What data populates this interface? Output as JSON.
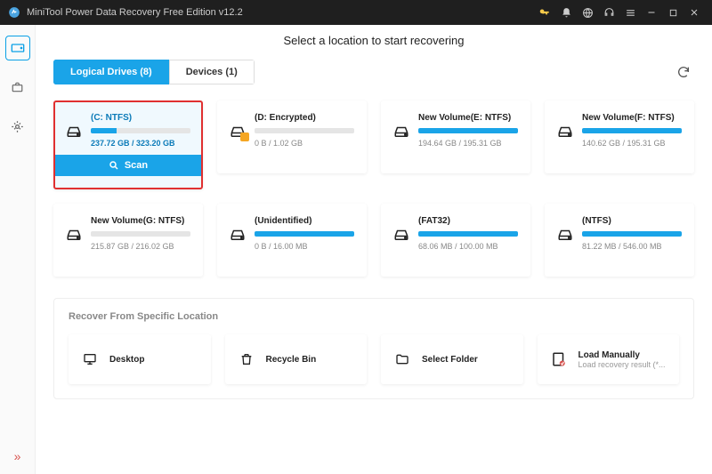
{
  "window": {
    "title": "MiniTool Power Data Recovery Free Edition v12.2"
  },
  "heading": "Select a location to start recovering",
  "tabs": {
    "logical": "Logical Drives (8)",
    "devices": "Devices (1)"
  },
  "drives": [
    {
      "label": "(C: NTFS)",
      "size": "237.72 GB / 323.20 GB",
      "fill": 26,
      "selected": true,
      "locked": false
    },
    {
      "label": "(D: Encrypted)",
      "size": "0 B / 1.02 GB",
      "fill": 0,
      "selected": false,
      "locked": true
    },
    {
      "label": "New Volume(E: NTFS)",
      "size": "194.64 GB / 195.31 GB",
      "fill": 100,
      "selected": false,
      "locked": false
    },
    {
      "label": "New Volume(F: NTFS)",
      "size": "140.62 GB / 195.31 GB",
      "fill": 100,
      "selected": false,
      "locked": false
    },
    {
      "label": "New Volume(G: NTFS)",
      "size": "215.87 GB / 216.02 GB",
      "fill": 0,
      "selected": false,
      "locked": false
    },
    {
      "label": "(Unidentified)",
      "size": "0 B / 16.00 MB",
      "fill": 100,
      "selected": false,
      "locked": false
    },
    {
      "label": "(FAT32)",
      "size": "68.06 MB / 100.00 MB",
      "fill": 100,
      "selected": false,
      "locked": false
    },
    {
      "label": "(NTFS)",
      "size": "81.22 MB / 546.00 MB",
      "fill": 100,
      "selected": false,
      "locked": false
    }
  ],
  "scan_label": "Scan",
  "specific_section": "Recover From Specific Location",
  "locations": {
    "desktop": "Desktop",
    "recycle": "Recycle Bin",
    "folder": "Select Folder",
    "manual_title": "Load Manually",
    "manual_sub": "Load recovery result (*..."
  }
}
